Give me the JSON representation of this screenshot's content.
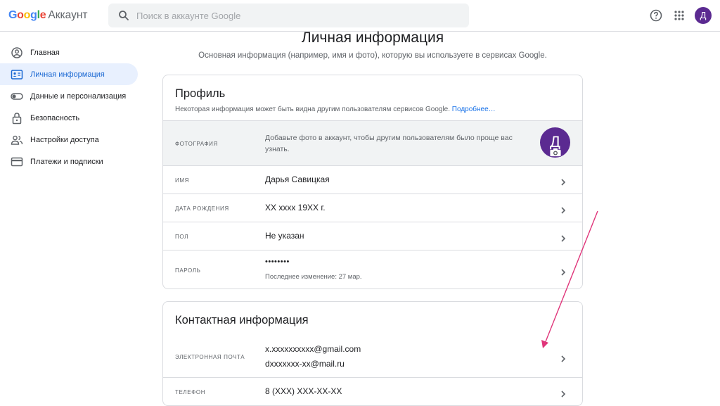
{
  "header": {
    "logo_google": "Google",
    "logo_product": "Аккаунт",
    "search_placeholder": "Поиск в аккаунте Google",
    "avatar_letter": "Д",
    "help_icon": "help-icon",
    "apps_icon": "apps-grid-icon"
  },
  "sidebar": {
    "items": [
      {
        "label": "Главная",
        "icon": "home-icon"
      },
      {
        "label": "Личная информация",
        "icon": "id-card-icon",
        "active": true
      },
      {
        "label": "Данные и персонализация",
        "icon": "toggle-icon"
      },
      {
        "label": "Безопасность",
        "icon": "lock-icon"
      },
      {
        "label": "Настройки доступа",
        "icon": "people-icon"
      },
      {
        "label": "Платежи и подписки",
        "icon": "credit-card-icon"
      }
    ]
  },
  "main": {
    "title": "Личная информация",
    "subtitle": "Основная информация (например, имя и фото), которую вы используете в сервисах Google."
  },
  "profile": {
    "title": "Профиль",
    "desc": "Некоторая информация может быть видна другим пользователям сервисов Google.",
    "desc_link": "Подробнее…",
    "photo_label": "ФОТОГРАФИЯ",
    "photo_text": "Добавьте фото в аккаунт, чтобы другим пользователям было проще вас узнать.",
    "photo_letter": "Д",
    "name_label": "ИМЯ",
    "name_value": "Дарья Савицкая",
    "birth_label": "ДАТА РОЖДЕНИЯ",
    "birth_value": "XX xxxx 19XX г.",
    "gender_label": "ПОЛ",
    "gender_value": "Не указан",
    "password_label": "ПАРОЛЬ",
    "password_value": "••••••••",
    "password_changed": "Последнее изменение: 27 мар."
  },
  "contact": {
    "title": "Контактная информация",
    "email_label": "ЭЛЕКТРОННАЯ ПОЧТА",
    "email_1": "x.xxxxxxxxxx@gmail.com",
    "email_2": "dxxxxxxx-xx@mail.ru",
    "phone_label": "ТЕЛЕФОН",
    "phone_value": "8 (XXX) XXX-XX-XX"
  },
  "colors": {
    "accent": "#1a73e8",
    "avatar": "#5b2a91",
    "annotation_arrow": "#e0357a",
    "active_nav_bg": "#e8f0fe"
  }
}
